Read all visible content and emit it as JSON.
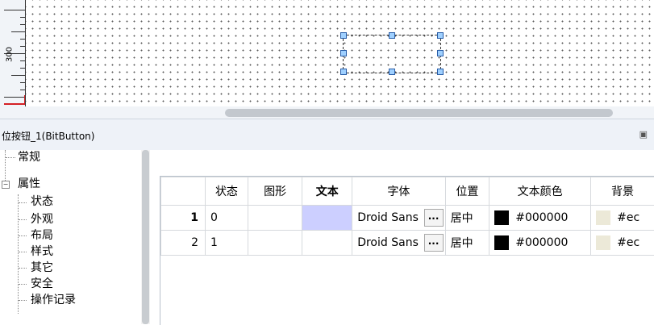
{
  "ruler": {
    "label": "300"
  },
  "panel": {
    "title": "位按钮_1(BitButton)"
  },
  "tree": {
    "items": [
      "常规",
      "属性",
      "状态",
      "外观",
      "布局",
      "样式",
      "其它",
      "安全",
      "操作记录"
    ],
    "toggle": "−"
  },
  "table": {
    "headers": [
      "",
      "状态",
      "图形",
      "文本",
      "字体",
      "位置",
      "文本颜色",
      "背景"
    ],
    "rows": [
      {
        "num": "1",
        "state": "0",
        "graphic": "",
        "text": "",
        "font": "Droid Sans",
        "font_btn": "...",
        "position": "居中",
        "text_color": "#000000",
        "bg_color": "#ec"
      },
      {
        "num": "2",
        "state": "1",
        "graphic": "",
        "text": "",
        "font": "Droid Sans",
        "font_btn": "...",
        "position": "居中",
        "text_color": "#000000",
        "bg_color": "#ec"
      }
    ]
  },
  "colors": {
    "text_swatch": "#000000",
    "bg_swatch": "#ece9d8",
    "selected_cell": "#cccfff"
  }
}
